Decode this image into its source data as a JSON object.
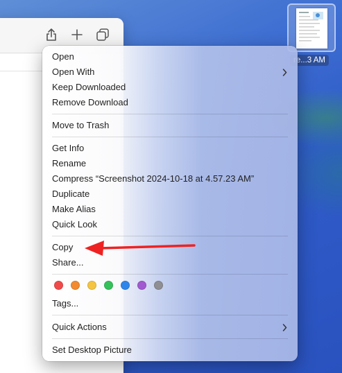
{
  "desktop_file": {
    "label": "re...3 AM"
  },
  "menu": {
    "items": [
      {
        "label": "Open"
      },
      {
        "label": "Open With"
      },
      {
        "label": "Keep Downloaded"
      },
      {
        "label": "Remove Download"
      },
      {
        "label": "Move to Trash"
      },
      {
        "label": "Get Info"
      },
      {
        "label": "Rename"
      },
      {
        "label": "Compress “Screenshot 2024-10-18 at 4.57.23 AM”"
      },
      {
        "label": "Duplicate"
      },
      {
        "label": "Make Alias"
      },
      {
        "label": "Quick Look"
      },
      {
        "label": "Copy"
      },
      {
        "label": "Share..."
      },
      {
        "label": "Tags..."
      },
      {
        "label": "Quick Actions"
      },
      {
        "label": "Set Desktop Picture"
      }
    ],
    "tag_colors": [
      "#f04b4b",
      "#f28a30",
      "#f5c542",
      "#36c15a",
      "#2f86ea",
      "#a25ad0",
      "#8e8e93"
    ]
  },
  "annotation": {
    "arrow_color": "#ee2222"
  }
}
